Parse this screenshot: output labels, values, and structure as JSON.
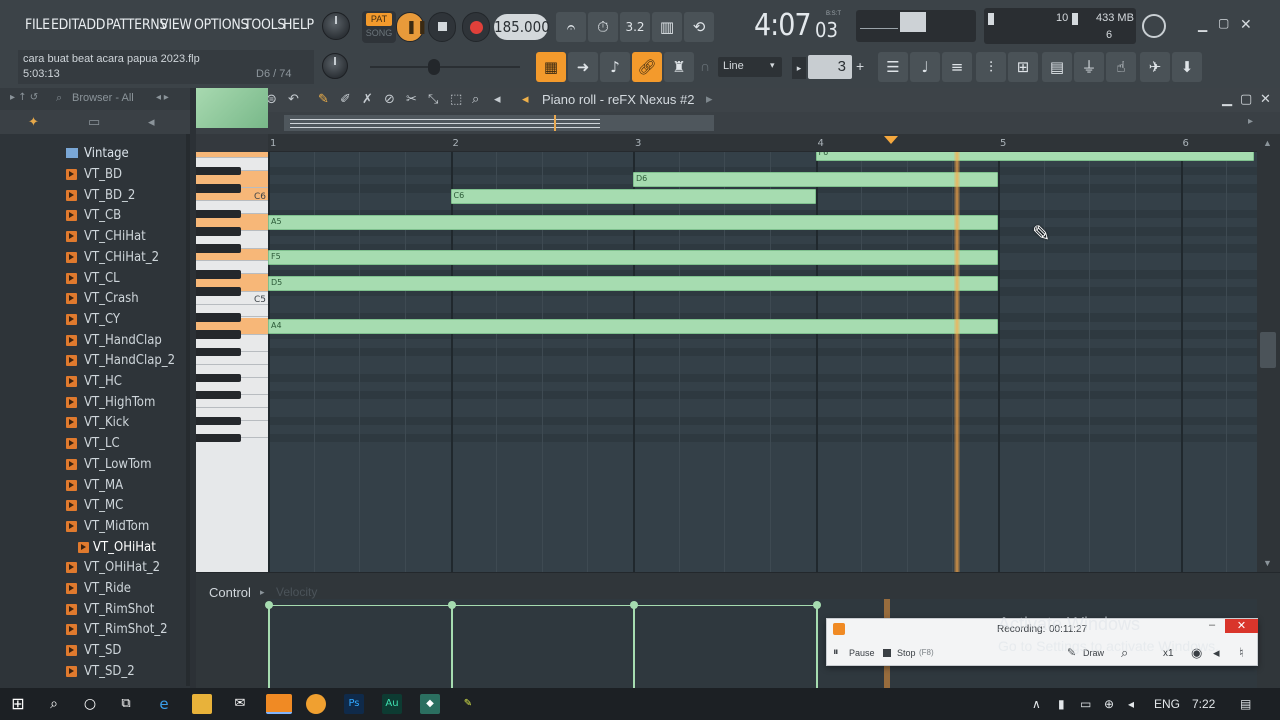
{
  "menu": [
    "FILE",
    "EDIT",
    "ADD",
    "PATTERNS",
    "VIEW",
    "OPTIONS",
    "TOOLS",
    "HELP"
  ],
  "transport": {
    "pat_label": "PAT",
    "song_label": "SONG",
    "tempo": "185.000",
    "time_main": "4:07",
    "time_sub": "03",
    "time_unit": "B:S:T",
    "snap_mode": "Line",
    "step_value": "3"
  },
  "project": {
    "filename": "cara buat beat acara papua 2023.flp",
    "duration": "5:03:13",
    "pattern_info": "D6 / 74"
  },
  "meters": {
    "cpu_value": "10",
    "memory": "433 MB",
    "polyphony": "6"
  },
  "browser": {
    "title": "Browser - All",
    "folder": "Vintage",
    "items": [
      "VT_BD",
      "VT_BD_2",
      "VT_CB",
      "VT_CHiHat",
      "VT_CHiHat_2",
      "VT_CL",
      "VT_Crash",
      "VT_CY",
      "VT_HandClap",
      "VT_HandClap_2",
      "VT_HC",
      "VT_HighTom",
      "VT_Kick",
      "VT_LC",
      "VT_LowTom",
      "VT_MA",
      "VT_MC",
      "VT_MidTom",
      "VT_OHiHat",
      "VT_OHiHat_2",
      "VT_Ride",
      "VT_RimShot",
      "VT_RimShot_2",
      "VT_SD",
      "VT_SD_2"
    ],
    "selected": "VT_OHiHat"
  },
  "piano_roll": {
    "title": "Piano roll - reFX Nexus #2",
    "bars": [
      "1",
      "2",
      "3",
      "4",
      "5",
      "6"
    ],
    "key_labels": [
      "C6",
      "C5"
    ],
    "notes": [
      {
        "label": "F6"
      },
      {
        "label": "D6"
      },
      {
        "label": "C6"
      },
      {
        "label": "A5"
      },
      {
        "label": "F5"
      },
      {
        "label": "D5"
      },
      {
        "label": "A4"
      }
    ],
    "control_label": "Control",
    "control_param": "Velocity"
  },
  "recorder": {
    "status_label": "Recording:",
    "elapsed": "00:11:27",
    "pause_label": "Pause",
    "stop_label": "Stop",
    "stop_hotkey": "(F8)",
    "draw_label": "Draw",
    "zoom_label": "x1"
  },
  "watermark": {
    "line1": "Activate Windows",
    "line2": "Go to Settings to activate Windows."
  },
  "taskbar": {
    "language": "ENG",
    "clock": "7:22"
  },
  "colors": {
    "note_fill": "#a6dcb0",
    "key_highlight": "#f7b778",
    "accent_orange": "#f39a2c",
    "playhead": "#ffaa46"
  }
}
